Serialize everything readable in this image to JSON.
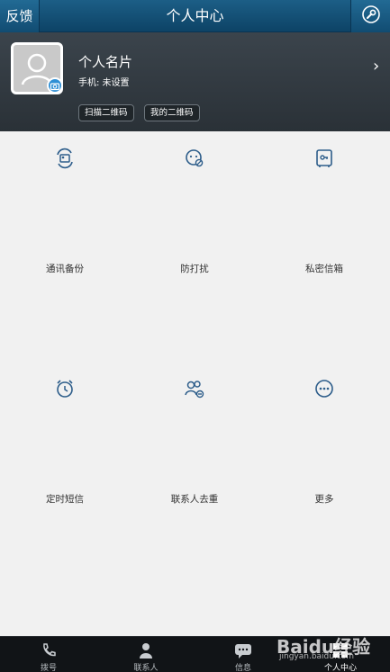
{
  "header": {
    "feedback_label": "反馈",
    "title": "个人中心"
  },
  "profile": {
    "name": "个人名片",
    "phone": "手机: 未设置",
    "scan_qr_label": "扫描二维码",
    "my_qr_label": "我的二维码"
  },
  "grid": {
    "items": [
      {
        "label": "通讯备份",
        "icon": "contacts-backup-icon"
      },
      {
        "label": "防打扰",
        "icon": "do-not-disturb-icon"
      },
      {
        "label": "私密信箱",
        "icon": "private-mailbox-icon"
      },
      {
        "label": "定时短信",
        "icon": "alarm-clock-icon"
      },
      {
        "label": "联系人去重",
        "icon": "dedupe-contacts-icon"
      },
      {
        "label": "更多",
        "icon": "more-icon"
      }
    ]
  },
  "bottom_nav": {
    "tabs": [
      {
        "label": "拨号",
        "icon": "phone-icon"
      },
      {
        "label": "联系人",
        "icon": "person-icon"
      },
      {
        "label": "信息",
        "icon": "message-icon"
      },
      {
        "label": "个人中心",
        "icon": "user-center-icon",
        "active": true
      }
    ]
  },
  "watermark": {
    "brand": "Baidu经验",
    "url": "jingyan.baidu.com"
  },
  "colors": {
    "accent_blue": "#1c5e86",
    "icon_blue": "#2d5d8a",
    "profile_bg": "#333b42"
  }
}
